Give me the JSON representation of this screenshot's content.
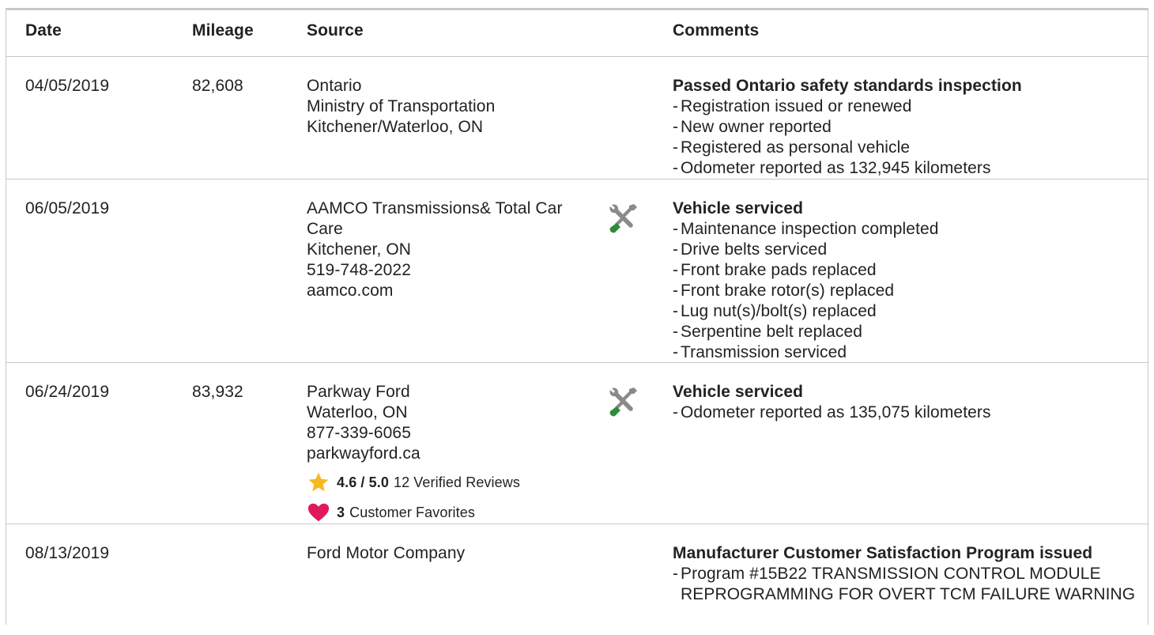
{
  "table": {
    "headers": {
      "date": "Date",
      "mileage": "Mileage",
      "source": "Source",
      "comments": "Comments"
    },
    "rows": [
      {
        "date": "04/05/2019",
        "mileage": "82,608",
        "source": [
          "Ontario",
          "Ministry of Transportation",
          "Kitchener/Waterloo, ON"
        ],
        "comment_title": "Passed Ontario safety standards inspection",
        "comment_items": [
          "Registration issued or renewed",
          "New owner reported",
          "Registered as personal vehicle",
          "Odometer reported as 132,945 kilometers"
        ]
      },
      {
        "date": "06/05/2019",
        "mileage": "",
        "source": [
          "AAMCO Transmissions& Total Car Care",
          "Kitchener, ON",
          "519-748-2022",
          "aamco.com"
        ],
        "icon": "service-tools-icon",
        "comment_title": "Vehicle serviced",
        "comment_items": [
          "Maintenance inspection completed",
          "Drive belts serviced",
          "Front brake pads replaced",
          "Front brake rotor(s) replaced",
          "Lug nut(s)/bolt(s) replaced",
          "Serpentine belt replaced",
          "Transmission serviced"
        ]
      },
      {
        "date": "06/24/2019",
        "mileage": "83,932",
        "source": [
          "Parkway Ford",
          "Waterloo, ON",
          "877-339-6065",
          "parkwayford.ca"
        ],
        "rating": {
          "score": "4.6 / 5.0",
          "reviews": "12 Verified Reviews"
        },
        "favorites": {
          "count": "3",
          "label": "Customer Favorites"
        },
        "icon": "service-tools-icon",
        "comment_title": "Vehicle serviced",
        "comment_items": [
          "Odometer reported as 135,075 kilometers"
        ]
      },
      {
        "date": "08/13/2019",
        "mileage": "",
        "source": [
          "Ford Motor Company"
        ],
        "comment_title": "Manufacturer Customer Satisfaction Program issued",
        "comment_items": [
          "Program #15B22 TRANSMISSION CONTROL MODULE REPROGRAMMING FOR OVERT TCM FAILURE WARNING"
        ]
      }
    ]
  },
  "colors": {
    "border": "#c8c8c8",
    "text": "#222222",
    "star": "#f5b921",
    "heart": "#e0195f",
    "wrench_gray": "#8a8a8a",
    "screwdriver_green": "#2e8b3a"
  }
}
